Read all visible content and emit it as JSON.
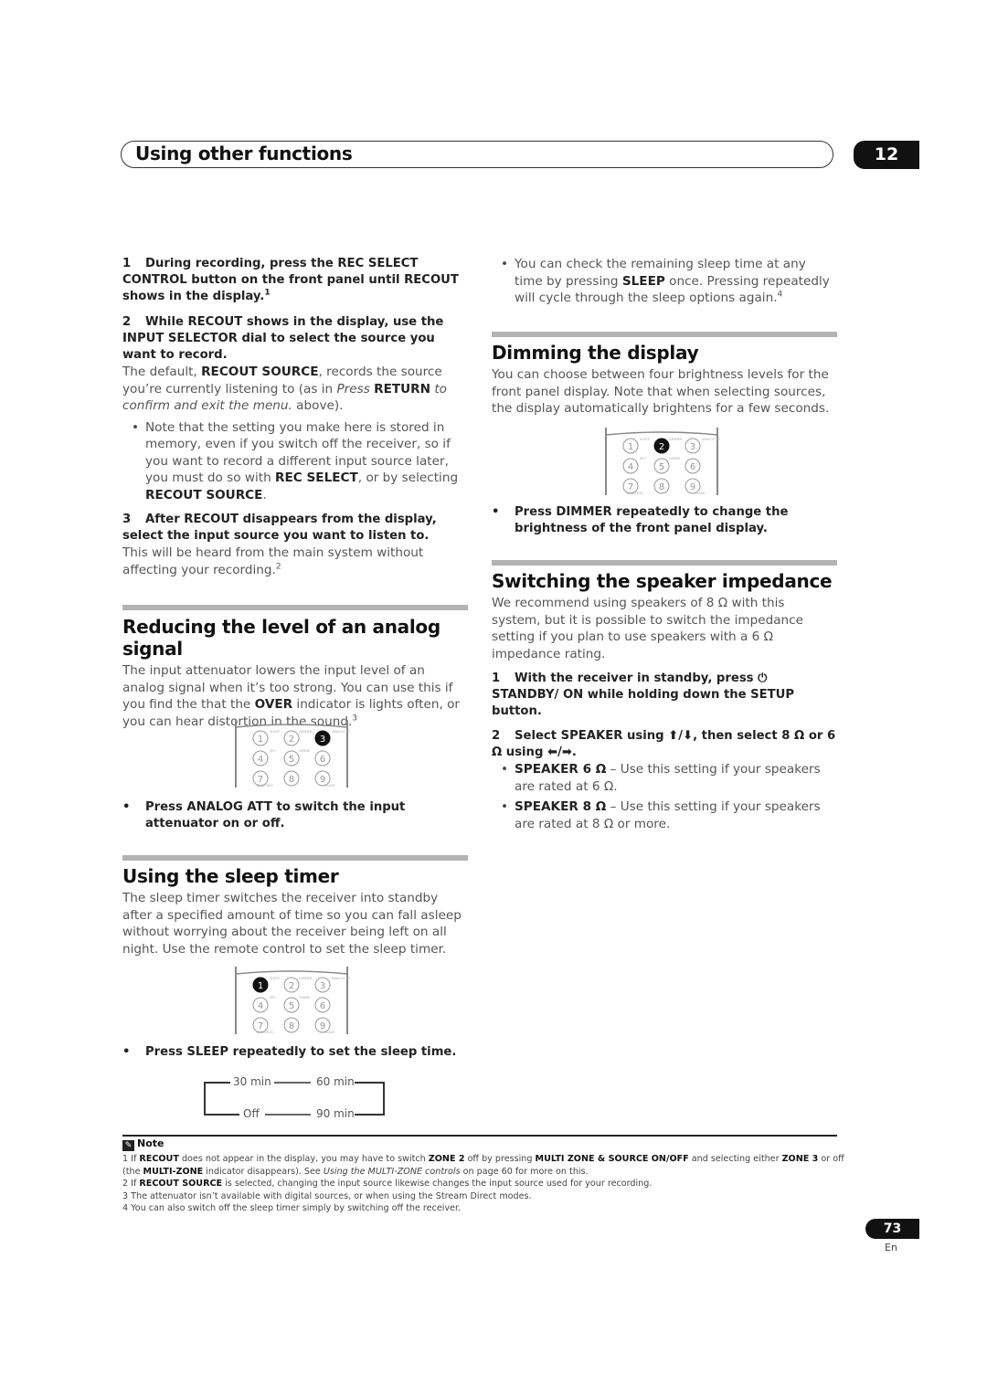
{
  "header": {
    "title": "Using other functions",
    "chapter": "12"
  },
  "left": {
    "step1": {
      "num": "1",
      "text": "During recording, press the REC SELECT CONTROL button on the front panel until RECOUT shows in the display.",
      "sup": "1"
    },
    "step2": {
      "num": "2",
      "text": "While RECOUT shows in the display, use the INPUT SELECTOR dial to select the source you want to record."
    },
    "step2_body": {
      "t1": "The default, ",
      "b1": "RECOUT SOURCE",
      "t2": ", records the source you’re currently listening to (as in ",
      "i1": "Press ",
      "b2": "RETURN",
      "i2": " to confirm and exit the menu.",
      "t3": " above)."
    },
    "bullet1": {
      "t1": "Note that the setting you make here is stored in memory, even if you switch off the receiver, so if you want to record a different input source later, you must do so with ",
      "b1": "REC SELECT",
      "t2": ", or by selecting ",
      "b2": "RECOUT SOURCE",
      "t3": "."
    },
    "step3": {
      "num": "3",
      "text": "After RECOUT disappears from the display, select the input source you want to listen to."
    },
    "step3_body": {
      "text": "This will be heard from the main system without affecting your recording.",
      "sup": "2"
    },
    "analog": {
      "heading": "Reducing the level of an analog signal",
      "body": {
        "t1": "The input attenuator lowers the input level of an analog signal when it’s too strong. You can use this if you find the that the ",
        "b1": "OVER",
        "t2": " indicator is lights often, or you can hear distortion in the sound.",
        "sup": "3"
      },
      "instruction": "Press ANALOG ATT to switch the input attenuator on or off."
    },
    "sleep": {
      "heading": "Using the sleep timer",
      "body": "The sleep timer switches the receiver into standby after a specified amount of time so you can fall asleep without worrying about the receiver being left on all night. Use the remote control to set the sleep timer.",
      "instruction": "Press SLEEP repeatedly to set the sleep time.",
      "cycle": [
        "30 min",
        "60 min",
        "90 min",
        "Off"
      ]
    }
  },
  "right": {
    "sleep_bullet": {
      "t1": "You can check the remaining sleep time at any time by pressing ",
      "b1": "SLEEP",
      "t2": " once. Pressing repeatedly will cycle through the sleep options again.",
      "sup": "4"
    },
    "dimmer": {
      "heading": "Dimming the display",
      "body": "You can choose between four brightness levels for the front panel display. Note that when selecting sources, the display automatically brightens for a few seconds.",
      "instruction": "Press DIMMER repeatedly to change the brightness of the front panel display."
    },
    "impedance": {
      "heading": "Switching the speaker impedance",
      "body": "We recommend using speakers of 8 Ω with this system, but it is possible to switch the impedance setting if you plan to use speakers with a 6 Ω impedance rating.",
      "step1": {
        "num": "1",
        "t1": "With the receiver in standby, press ",
        "icon": "⏻",
        "t2": " STANDBY/ ON while holding down the SETUP button."
      },
      "step2": {
        "num": "2",
        "text": "Select SPEAKER using ⬆/⬇, then select 8 Ω or 6 Ω using ⬅/➡."
      },
      "opt6": {
        "b": "SPEAKER 6 Ω",
        "t": " – Use this setting if your speakers are rated at 6 Ω."
      },
      "opt8": {
        "b": "SPEAKER 8 Ω",
        "t": " – Use this setting if your speakers are rated at 8 Ω or more."
      }
    }
  },
  "remote": {
    "keys": [
      "1",
      "2",
      "3",
      "4",
      "5",
      "6",
      "7",
      "8",
      "9"
    ],
    "labels": {
      "sleep": "SLEEP",
      "dimmer": "DIMMER",
      "analog_att": "ANALOG ATT",
      "sr": "SR+",
      "genre": "GENRE",
      "d_access": "D.ACCESS",
      "class": "CLASS"
    }
  },
  "notes": {
    "title": "Note",
    "n1": {
      "n": "1",
      "t1": " If ",
      "b1": "RECOUT",
      "t2": " does not appear in the display, you may have to switch ",
      "b2": "ZONE 2",
      "t3": " off by pressing ",
      "b3": "MULTI ZONE & SOURCE ON/OFF",
      "t4": " and selecting either ",
      "b4": "ZONE 3",
      "t5": " or off (the ",
      "b5": "MULTI-ZONE",
      "t6": " indicator disappears). See ",
      "i1": "Using the MULTI-ZONE controls",
      "t7": " on page 60 for more on this."
    },
    "n2": {
      "n": "2",
      "t1": " If ",
      "b1": "RECOUT SOURCE",
      "t2": " is selected, changing the input source likewise changes the input source used for your recording."
    },
    "n3": "3 The attenuator isn’t available with digital sources, or when using the Stream Direct modes.",
    "n4": "4 You can also switch off the sleep timer simply by switching off the receiver."
  },
  "footer": {
    "page": "73",
    "lang": "En"
  }
}
